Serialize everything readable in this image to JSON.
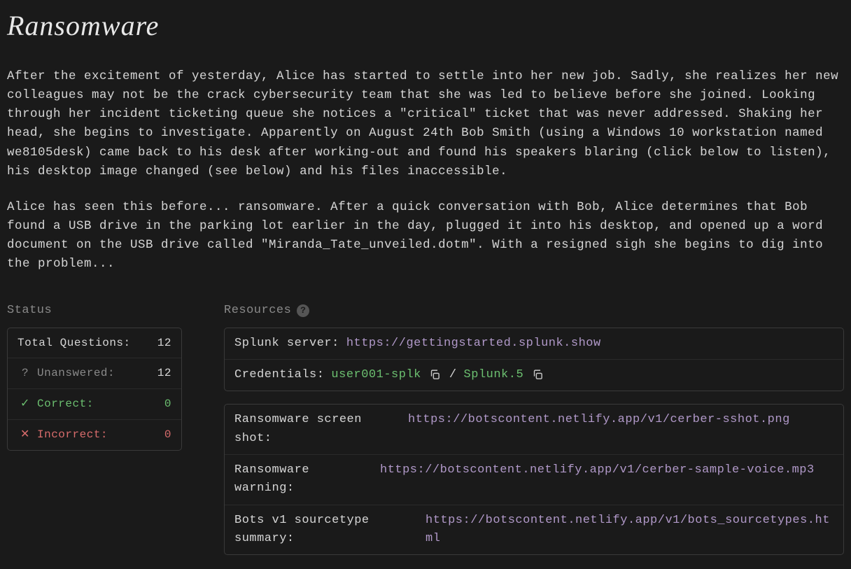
{
  "title": "Ransomware",
  "para1": "After the excitement of yesterday, Alice has started to settle into her new job. Sadly, she realizes her new colleagues may not be the crack cybersecurity team that she was led to believe before she joined. Looking through her incident ticketing queue she notices a \"critical\" ticket that was never addressed. Shaking her head, she begins to investigate. Apparently on August 24th Bob Smith (using a Windows 10 workstation named we8105desk) came back to his desk after working-out and found his speakers blaring (click below to listen), his desktop image changed (see below) and his files inaccessible.",
  "para2": "Alice has seen this before... ransomware. After a quick conversation with Bob, Alice determines that Bob found a USB drive in the parking lot earlier in the day, plugged it into his desktop, and opened up a word document on the USB drive called \"Miranda_Tate_unveiled.dotm\". With a resigned sigh she begins to dig into the problem...",
  "status": {
    "heading": "Status",
    "total_label": "Total Questions:",
    "total_value": "12",
    "unanswered_label": "Unanswered:",
    "unanswered_value": "12",
    "unanswered_icon": "?",
    "correct_label": "Correct:",
    "correct_value": "0",
    "correct_icon": "✓",
    "incorrect_label": "Incorrect:",
    "incorrect_value": "0",
    "incorrect_icon": "✕"
  },
  "resources": {
    "heading": "Resources",
    "help_glyph": "?",
    "server_label": "Splunk server:",
    "server_url": "https://gettingstarted.splunk.show",
    "creds_label": "Credentials:",
    "creds_user": "user001-splk",
    "creds_sep": "/",
    "creds_pass": "Splunk.5",
    "links": [
      {
        "label": "Ransomware screen shot:",
        "url": "https://botscontent.netlify.app/v1/cerber-sshot.png"
      },
      {
        "label": "Ransomware warning:",
        "url": "https://botscontent.netlify.app/v1/cerber-sample-voice.mp3"
      },
      {
        "label": "Bots v1 sourcetype summary:",
        "url": "https://botscontent.netlify.app/v1/bots_sourcetypes.html"
      }
    ]
  }
}
